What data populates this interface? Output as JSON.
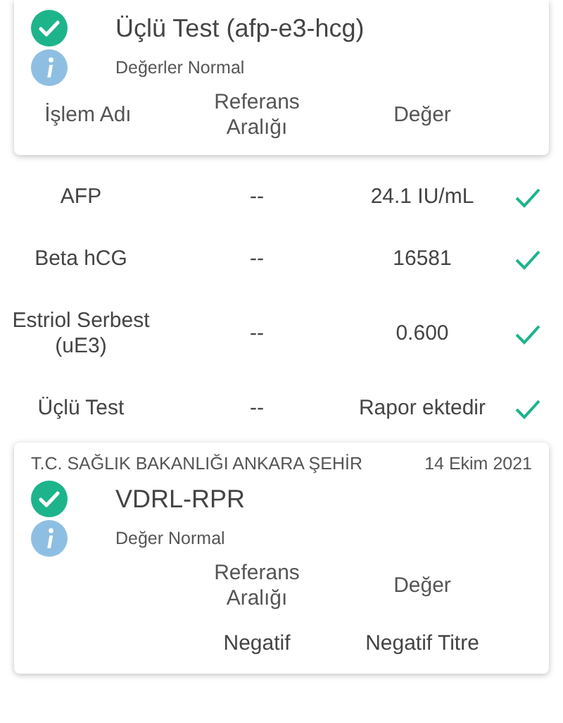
{
  "tests": [
    {
      "title": "Üçlü Test (afp-e3-hcg)",
      "status": "Değerler Normal",
      "columns": {
        "name": "İşlem Adı",
        "range": "Referans Aralığı",
        "value": "Değer"
      },
      "rows": [
        {
          "name": "AFP",
          "range": "--",
          "value": "24.1 IU/mL",
          "ok": true
        },
        {
          "name": "Beta hCG",
          "range": "--",
          "value": "16581",
          "ok": true
        },
        {
          "name": "Estriol Serbest (uE3)",
          "range": "--",
          "value": "0.600",
          "ok": true
        },
        {
          "name": "Üçlü Test",
          "range": "--",
          "value": "Rapor ektedir",
          "ok": true
        }
      ]
    },
    {
      "hospital": "T.C. SAĞLIK BAKANLIĞI ANKARA ŞEHİR",
      "date": "14 Ekim 2021",
      "title": "VDRL-RPR",
      "status": "Değer Normal",
      "columns": {
        "range": "Referans Aralığı",
        "value": "Değer"
      },
      "rows": [
        {
          "range": "Negatif",
          "value": "Negatif Titre"
        }
      ]
    }
  ]
}
